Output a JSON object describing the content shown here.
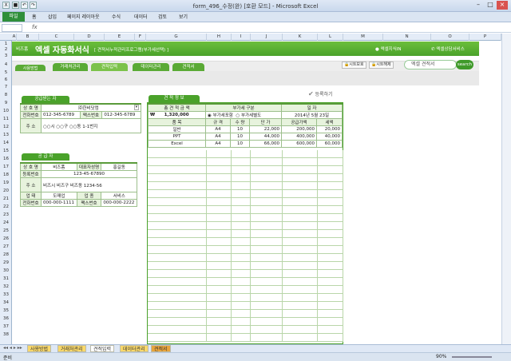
{
  "window": {
    "title": "form_496_수정(완) [호환 모드] - Microsoft Excel"
  },
  "ribbon": {
    "file_tab": "파일",
    "tabs": [
      "홈",
      "삽입",
      "페이지 레이아웃",
      "수식",
      "데이터",
      "검토",
      "보기"
    ]
  },
  "formula_bar": {
    "name_box": "",
    "fx": "fx",
    "value": ""
  },
  "columns": [
    "A",
    "B",
    "C",
    "D",
    "E",
    "F",
    "G",
    "H",
    "I",
    "J",
    "K",
    "L",
    "M",
    "N",
    "O",
    "P"
  ],
  "rows": [
    "1",
    "2",
    "3",
    "4",
    "5",
    "6",
    "7",
    "8",
    "9",
    "10",
    "11",
    "12",
    "13",
    "14",
    "15",
    "16",
    "17",
    "18",
    "19",
    "20",
    "21",
    "22",
    "23",
    "24",
    "25",
    "26",
    "27",
    "28",
    "29",
    "30",
    "31",
    "32",
    "33",
    "34",
    "35",
    "36",
    "37",
    "38",
    "39"
  ],
  "banner": {
    "logo_sub": "비즈폼",
    "logo_main": "엑셀 자동화서식",
    "desc": "[ 견적서누적관리프로그램(부가세선택) ]",
    "link_knowledge": "엑셀지식IN",
    "link_consult": "엑셀상담서비스"
  },
  "nav": {
    "tabs": [
      "사용방법",
      "거래처관리",
      "견적입력",
      "데이터관리",
      "견적서"
    ],
    "sheet_protect": "시트보호",
    "sheet_unprotect": "시트해제",
    "search_value": "엑셀 견적서",
    "search_btn": "search"
  },
  "register_button": "등록하기",
  "supplier_received": {
    "header": "공급받는 자",
    "company_label": "상 호 명",
    "company_value": "㈜한비닷컴",
    "phone_label": "전화번호",
    "phone_value": "012-345-6789",
    "fax_label": "팩스번호",
    "fax_value": "012-345-6789",
    "addr_label": "주    소",
    "addr_value": "○○시 ○○구 ○○동 1-1번지"
  },
  "supplier": {
    "header": "공 급 자",
    "company_label": "상 호 명",
    "company_value": "비즈폼",
    "ceo_label": "대표자성명",
    "ceo_value": "홍길동",
    "reg_label": "등록번호",
    "reg_value": "123-45-67890",
    "addr_label": "주    소",
    "addr_value": "비즈시 비즈구 비즈동 1234-56",
    "biz_label": "업    태",
    "biz_value": "도매업",
    "item_label": "업    종",
    "item_value": "서비스",
    "phone_label": "전화번호",
    "phone_value": "000-000-1111",
    "fax_label": "팩스번호",
    "fax_value": "000-000-2222"
  },
  "estimate": {
    "header": "견 적 정 보",
    "total_label": "총 견 적 금 액",
    "vat_label": "부가세 구분",
    "date_label": "일        자",
    "currency": "₩",
    "total_value": "1,320,000",
    "vat_opt1": "부가세포함",
    "vat_opt2": "부가세별도",
    "vat_selected": "부가세포함",
    "date_value": "2014년 5월 23일",
    "col_headers": [
      "품     목",
      "규 격",
      "수 량",
      "단  가",
      "공급가액",
      "세액"
    ],
    "rows": [
      [
        "일반",
        "A4",
        "10",
        "22,000",
        "200,000",
        "20,000"
      ],
      [
        "PPT",
        "A4",
        "10",
        "44,000",
        "400,000",
        "40,000"
      ],
      [
        "Excel",
        "A4",
        "10",
        "66,000",
        "600,000",
        "60,000"
      ]
    ]
  },
  "sheet_tabs": [
    "사용방법",
    "거래처관리",
    "견적입력",
    "데이터관리",
    "견적서"
  ],
  "active_sheet": "견적입력",
  "status": {
    "ready": "준비",
    "zoom": "90%"
  }
}
